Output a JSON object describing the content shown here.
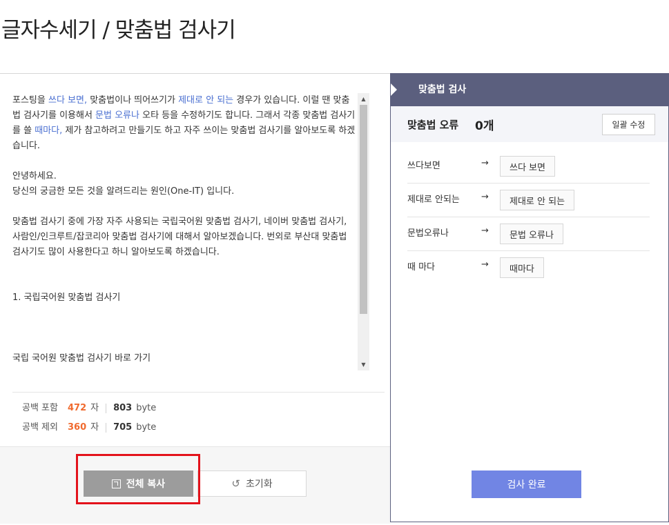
{
  "page": {
    "title": "글자수세기 / 맞춤법 검사기"
  },
  "editor": {
    "paragraphs": [
      {
        "parts": [
          {
            "text": "포스팅을 ",
            "hl": false
          },
          {
            "text": "쓰다 보면,",
            "hl": true
          },
          {
            "text": " 맞춤법이나 띄어쓰기가 ",
            "hl": false
          },
          {
            "text": "제대로 안 되는",
            "hl": true
          },
          {
            "text": " 경우가 있습니다. 이럴 땐 맞춤법 검사기를 이용해서 ",
            "hl": false
          },
          {
            "text": "문법 오류나",
            "hl": true
          },
          {
            "text": " 오타 등을 수정하기도 합니다. 그래서 각종 맞춤법 검사기를 쓸 ",
            "hl": false
          },
          {
            "text": "때마다,",
            "hl": true
          },
          {
            "text": " 제가 참고하려고 만들기도 하고 자주 쓰이는 맞춤법 검사기를 알아보도록 하겠습니다.",
            "hl": false
          }
        ],
        "gap_after": 1
      },
      {
        "parts": [
          {
            "text": "안녕하세요.",
            "hl": false
          }
        ],
        "gap_after": 0
      },
      {
        "parts": [
          {
            "text": "당신의 궁금한 모든 것을 알려드리는 원인(One-IT) 입니다.",
            "hl": false
          }
        ],
        "gap_after": 1
      },
      {
        "parts": [
          {
            "text": "맞춤법 검사기 중에 가장 자주 사용되는 국립국어원 맞춤법 검사기, 네이버 맞춤법 검사기, 사람인/인크루트/잡코리아 맞춤법 검사기에 대해서 알아보겠습니다. 번외로 부산대 맞춤법 검사기도 많이 사용한다고 하니 알아보도록 하겠습니다.",
            "hl": false
          }
        ],
        "gap_after": 2
      },
      {
        "parts": [
          {
            "text": "1. 국립국어원 맞춤법 검사기",
            "hl": false
          }
        ],
        "gap_after": 3
      },
      {
        "parts": [
          {
            "text": "국립 국어원 맞춤법 검사기 바로 가기",
            "hl": false
          }
        ],
        "gap_after": 0
      }
    ]
  },
  "scroll": {
    "up": "▲",
    "down": "▼"
  },
  "counts": {
    "with_space": {
      "label": "공백 포함",
      "chars": "472",
      "char_unit": "자",
      "bytes": "803",
      "byte_unit": "byte"
    },
    "without_space": {
      "label": "공백 제외",
      "chars": "360",
      "char_unit": "자",
      "bytes": "705",
      "byte_unit": "byte"
    }
  },
  "buttons": {
    "copy_all": "전체 복사",
    "reset": "초기화",
    "reset_icon": "↺"
  },
  "spellcheck": {
    "header": "맞춤법 검사",
    "error_label": "맞춤법 오류",
    "error_count": "0개",
    "fix_all": "일괄 수정",
    "arrow": "→",
    "corrections": [
      {
        "wrong": "쓰다보면",
        "suggestion": "쓰다 보면"
      },
      {
        "wrong": "제대로 안되는",
        "suggestion": "제대로 안 되는"
      },
      {
        "wrong": "문법오류나",
        "suggestion": "문법 오류나"
      },
      {
        "wrong": "때 마다",
        "suggestion": "때마다"
      }
    ],
    "done": "검사 완료"
  },
  "colors": {
    "accent_highlight": "#4a6fd1",
    "count_orange": "#f06a2e",
    "panel_header": "#5b5f7e",
    "done_button": "#7185e4",
    "annotation_red": "#e3121b"
  }
}
